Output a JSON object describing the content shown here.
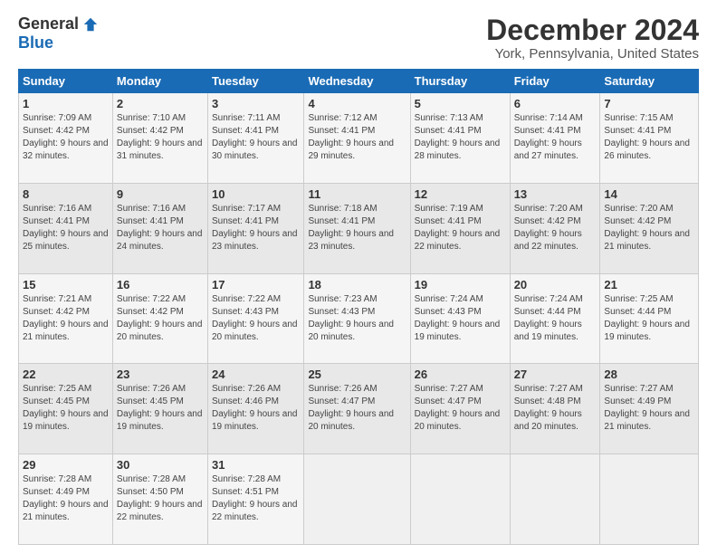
{
  "logo": {
    "general": "General",
    "blue": "Blue"
  },
  "title": "December 2024",
  "subtitle": "York, Pennsylvania, United States",
  "header_days": [
    "Sunday",
    "Monday",
    "Tuesday",
    "Wednesday",
    "Thursday",
    "Friday",
    "Saturday"
  ],
  "weeks": [
    [
      {
        "day": "1",
        "sunrise": "Sunrise: 7:09 AM",
        "sunset": "Sunset: 4:42 PM",
        "daylight": "Daylight: 9 hours and 32 minutes."
      },
      {
        "day": "2",
        "sunrise": "Sunrise: 7:10 AM",
        "sunset": "Sunset: 4:42 PM",
        "daylight": "Daylight: 9 hours and 31 minutes."
      },
      {
        "day": "3",
        "sunrise": "Sunrise: 7:11 AM",
        "sunset": "Sunset: 4:41 PM",
        "daylight": "Daylight: 9 hours and 30 minutes."
      },
      {
        "day": "4",
        "sunrise": "Sunrise: 7:12 AM",
        "sunset": "Sunset: 4:41 PM",
        "daylight": "Daylight: 9 hours and 29 minutes."
      },
      {
        "day": "5",
        "sunrise": "Sunrise: 7:13 AM",
        "sunset": "Sunset: 4:41 PM",
        "daylight": "Daylight: 9 hours and 28 minutes."
      },
      {
        "day": "6",
        "sunrise": "Sunrise: 7:14 AM",
        "sunset": "Sunset: 4:41 PM",
        "daylight": "Daylight: 9 hours and 27 minutes."
      },
      {
        "day": "7",
        "sunrise": "Sunrise: 7:15 AM",
        "sunset": "Sunset: 4:41 PM",
        "daylight": "Daylight: 9 hours and 26 minutes."
      }
    ],
    [
      {
        "day": "8",
        "sunrise": "Sunrise: 7:16 AM",
        "sunset": "Sunset: 4:41 PM",
        "daylight": "Daylight: 9 hours and 25 minutes."
      },
      {
        "day": "9",
        "sunrise": "Sunrise: 7:16 AM",
        "sunset": "Sunset: 4:41 PM",
        "daylight": "Daylight: 9 hours and 24 minutes."
      },
      {
        "day": "10",
        "sunrise": "Sunrise: 7:17 AM",
        "sunset": "Sunset: 4:41 PM",
        "daylight": "Daylight: 9 hours and 23 minutes."
      },
      {
        "day": "11",
        "sunrise": "Sunrise: 7:18 AM",
        "sunset": "Sunset: 4:41 PM",
        "daylight": "Daylight: 9 hours and 23 minutes."
      },
      {
        "day": "12",
        "sunrise": "Sunrise: 7:19 AM",
        "sunset": "Sunset: 4:41 PM",
        "daylight": "Daylight: 9 hours and 22 minutes."
      },
      {
        "day": "13",
        "sunrise": "Sunrise: 7:20 AM",
        "sunset": "Sunset: 4:42 PM",
        "daylight": "Daylight: 9 hours and 22 minutes."
      },
      {
        "day": "14",
        "sunrise": "Sunrise: 7:20 AM",
        "sunset": "Sunset: 4:42 PM",
        "daylight": "Daylight: 9 hours and 21 minutes."
      }
    ],
    [
      {
        "day": "15",
        "sunrise": "Sunrise: 7:21 AM",
        "sunset": "Sunset: 4:42 PM",
        "daylight": "Daylight: 9 hours and 21 minutes."
      },
      {
        "day": "16",
        "sunrise": "Sunrise: 7:22 AM",
        "sunset": "Sunset: 4:42 PM",
        "daylight": "Daylight: 9 hours and 20 minutes."
      },
      {
        "day": "17",
        "sunrise": "Sunrise: 7:22 AM",
        "sunset": "Sunset: 4:43 PM",
        "daylight": "Daylight: 9 hours and 20 minutes."
      },
      {
        "day": "18",
        "sunrise": "Sunrise: 7:23 AM",
        "sunset": "Sunset: 4:43 PM",
        "daylight": "Daylight: 9 hours and 20 minutes."
      },
      {
        "day": "19",
        "sunrise": "Sunrise: 7:24 AM",
        "sunset": "Sunset: 4:43 PM",
        "daylight": "Daylight: 9 hours and 19 minutes."
      },
      {
        "day": "20",
        "sunrise": "Sunrise: 7:24 AM",
        "sunset": "Sunset: 4:44 PM",
        "daylight": "Daylight: 9 hours and 19 minutes."
      },
      {
        "day": "21",
        "sunrise": "Sunrise: 7:25 AM",
        "sunset": "Sunset: 4:44 PM",
        "daylight": "Daylight: 9 hours and 19 minutes."
      }
    ],
    [
      {
        "day": "22",
        "sunrise": "Sunrise: 7:25 AM",
        "sunset": "Sunset: 4:45 PM",
        "daylight": "Daylight: 9 hours and 19 minutes."
      },
      {
        "day": "23",
        "sunrise": "Sunrise: 7:26 AM",
        "sunset": "Sunset: 4:45 PM",
        "daylight": "Daylight: 9 hours and 19 minutes."
      },
      {
        "day": "24",
        "sunrise": "Sunrise: 7:26 AM",
        "sunset": "Sunset: 4:46 PM",
        "daylight": "Daylight: 9 hours and 19 minutes."
      },
      {
        "day": "25",
        "sunrise": "Sunrise: 7:26 AM",
        "sunset": "Sunset: 4:47 PM",
        "daylight": "Daylight: 9 hours and 20 minutes."
      },
      {
        "day": "26",
        "sunrise": "Sunrise: 7:27 AM",
        "sunset": "Sunset: 4:47 PM",
        "daylight": "Daylight: 9 hours and 20 minutes."
      },
      {
        "day": "27",
        "sunrise": "Sunrise: 7:27 AM",
        "sunset": "Sunset: 4:48 PM",
        "daylight": "Daylight: 9 hours and 20 minutes."
      },
      {
        "day": "28",
        "sunrise": "Sunrise: 7:27 AM",
        "sunset": "Sunset: 4:49 PM",
        "daylight": "Daylight: 9 hours and 21 minutes."
      }
    ],
    [
      {
        "day": "29",
        "sunrise": "Sunrise: 7:28 AM",
        "sunset": "Sunset: 4:49 PM",
        "daylight": "Daylight: 9 hours and 21 minutes."
      },
      {
        "day": "30",
        "sunrise": "Sunrise: 7:28 AM",
        "sunset": "Sunset: 4:50 PM",
        "daylight": "Daylight: 9 hours and 22 minutes."
      },
      {
        "day": "31",
        "sunrise": "Sunrise: 7:28 AM",
        "sunset": "Sunset: 4:51 PM",
        "daylight": "Daylight: 9 hours and 22 minutes."
      },
      null,
      null,
      null,
      null
    ]
  ]
}
